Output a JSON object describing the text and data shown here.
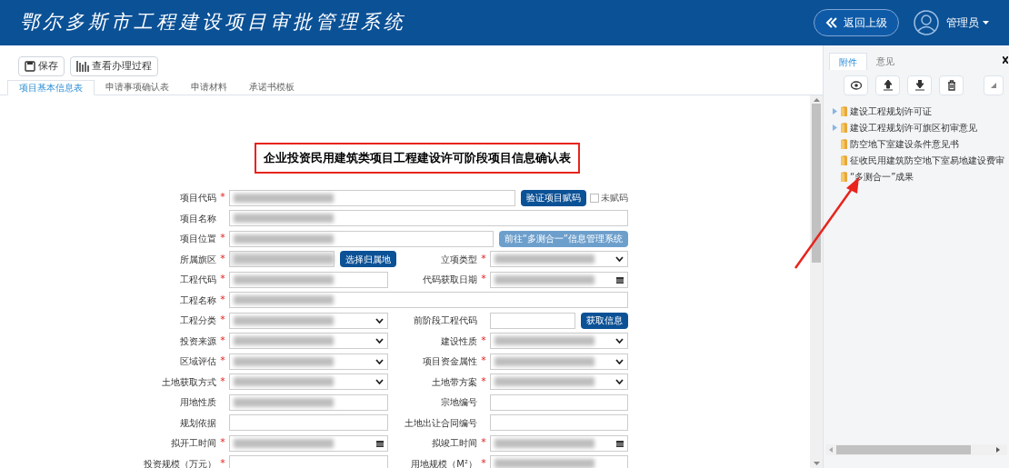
{
  "header": {
    "title": "鄂尔多斯市工程建设项目审批管理系统",
    "back_button": "返回上级",
    "user": "管理员"
  },
  "toolbar": [
    {
      "kind": "save",
      "label": "保存"
    },
    {
      "kind": "process",
      "label": "查看办理过程"
    }
  ],
  "tabs": [
    {
      "label": "项目基本信息表",
      "selected": true
    },
    {
      "label": "申请事项确认表",
      "selected": false
    },
    {
      "label": "申请材料",
      "selected": false
    },
    {
      "label": "承诺书模板",
      "selected": false
    }
  ],
  "form": {
    "title": "企业投资民用建筑类项目工程建设许可阶段项目信息确认表",
    "rows": [
      {
        "fields": [
          {
            "label": "项目代码",
            "required_mark": "*",
            "kind": "text",
            "redacted": true,
            "button": {
              "label": "验证项目赋码",
              "kind": "primary"
            },
            "checkbox": {
              "label": "未赋码",
              "checked": false
            }
          }
        ]
      },
      {
        "fields": [
          {
            "label": "项目名称",
            "kind": "text",
            "redacted": true
          }
        ]
      },
      {
        "fields": [
          {
            "label": "项目位置",
            "required_mark": "*",
            "kind": "text",
            "redacted": true,
            "button": {
              "label": "前往“多测合一”信息管理系统",
              "kind": "light"
            }
          }
        ]
      },
      {
        "fields": [
          {
            "label": "所属旗区",
            "required_mark": "*",
            "kind": "readonly",
            "redacted": true,
            "button": {
              "label": "选择归属地",
              "kind": "primary"
            }
          },
          {
            "label": "立项类型",
            "required_mark": "*",
            "kind": "select",
            "redacted": true
          }
        ]
      },
      {
        "fields": [
          {
            "label": "工程代码",
            "required_mark": "*",
            "kind": "text",
            "redacted": true
          },
          {
            "label": "代码获取日期",
            "required_mark": "*",
            "kind": "date",
            "redacted": true
          }
        ]
      },
      {
        "fields": [
          {
            "label": "工程名称",
            "required_mark": "*",
            "kind": "text",
            "redacted": true
          }
        ]
      },
      {
        "fields": [
          {
            "label": "工程分类",
            "required_mark": "*",
            "kind": "select",
            "redacted": true
          },
          {
            "label": "前阶段工程代码",
            "kind": "text",
            "redacted": false,
            "button": {
              "label": "获取信息",
              "kind": "primary"
            }
          }
        ]
      },
      {
        "fields": [
          {
            "label": "投资来源",
            "required_mark": "*",
            "kind": "select",
            "redacted": true
          },
          {
            "label": "建设性质",
            "required_mark": "*",
            "kind": "select",
            "redacted": true
          }
        ]
      },
      {
        "fields": [
          {
            "label": "区域评估",
            "required_mark": "*",
            "kind": "select",
            "redacted": true
          },
          {
            "label": "项目资金属性",
            "required_mark": "*",
            "kind": "select",
            "redacted": true
          }
        ]
      },
      {
        "fields": [
          {
            "label": "土地获取方式",
            "required_mark": "*",
            "kind": "select",
            "redacted": true
          },
          {
            "label": "土地带方案",
            "required_mark": "*",
            "kind": "select",
            "redacted": true
          }
        ]
      },
      {
        "fields": [
          {
            "label": "用地性质",
            "kind": "text",
            "redacted": true
          },
          {
            "label": "宗地编号",
            "kind": "text",
            "redacted": false
          }
        ]
      },
      {
        "fields": [
          {
            "label": "规划依据",
            "kind": "text",
            "redacted": false
          },
          {
            "label": "土地出让合同编号",
            "kind": "text",
            "redacted": false
          }
        ]
      },
      {
        "fields": [
          {
            "label": "拟开工时间",
            "required_mark": "*",
            "kind": "date",
            "redacted": true
          },
          {
            "label": "拟竣工时间",
            "required_mark": "*",
            "kind": "date",
            "redacted": true
          }
        ]
      },
      {
        "fields": [
          {
            "label": "投资规模（万元）",
            "required_mark": "*",
            "kind": "text",
            "redacted": false
          },
          {
            "label": "用地规模（M²）",
            "required_mark": "*",
            "kind": "text",
            "redacted": true
          }
        ]
      }
    ]
  },
  "side_panel": {
    "tabs": [
      {
        "label": "附件",
        "selected": true
      },
      {
        "label": "意见",
        "selected": false
      }
    ],
    "actions": [
      {
        "kind": "view"
      },
      {
        "kind": "upload"
      },
      {
        "kind": "download"
      },
      {
        "kind": "delete"
      }
    ],
    "tree": [
      {
        "label": "建设工程规划许可证",
        "has_children": true
      },
      {
        "label": "建设工程规划许可旗区初审意见",
        "has_children": true
      },
      {
        "label": "防空地下室建设条件意见书",
        "has_children": false
      },
      {
        "label": "征收民用建筑防空地下室易地建设费审",
        "has_children": false
      },
      {
        "label": "“多测合一”成果",
        "has_children": false
      }
    ]
  }
}
